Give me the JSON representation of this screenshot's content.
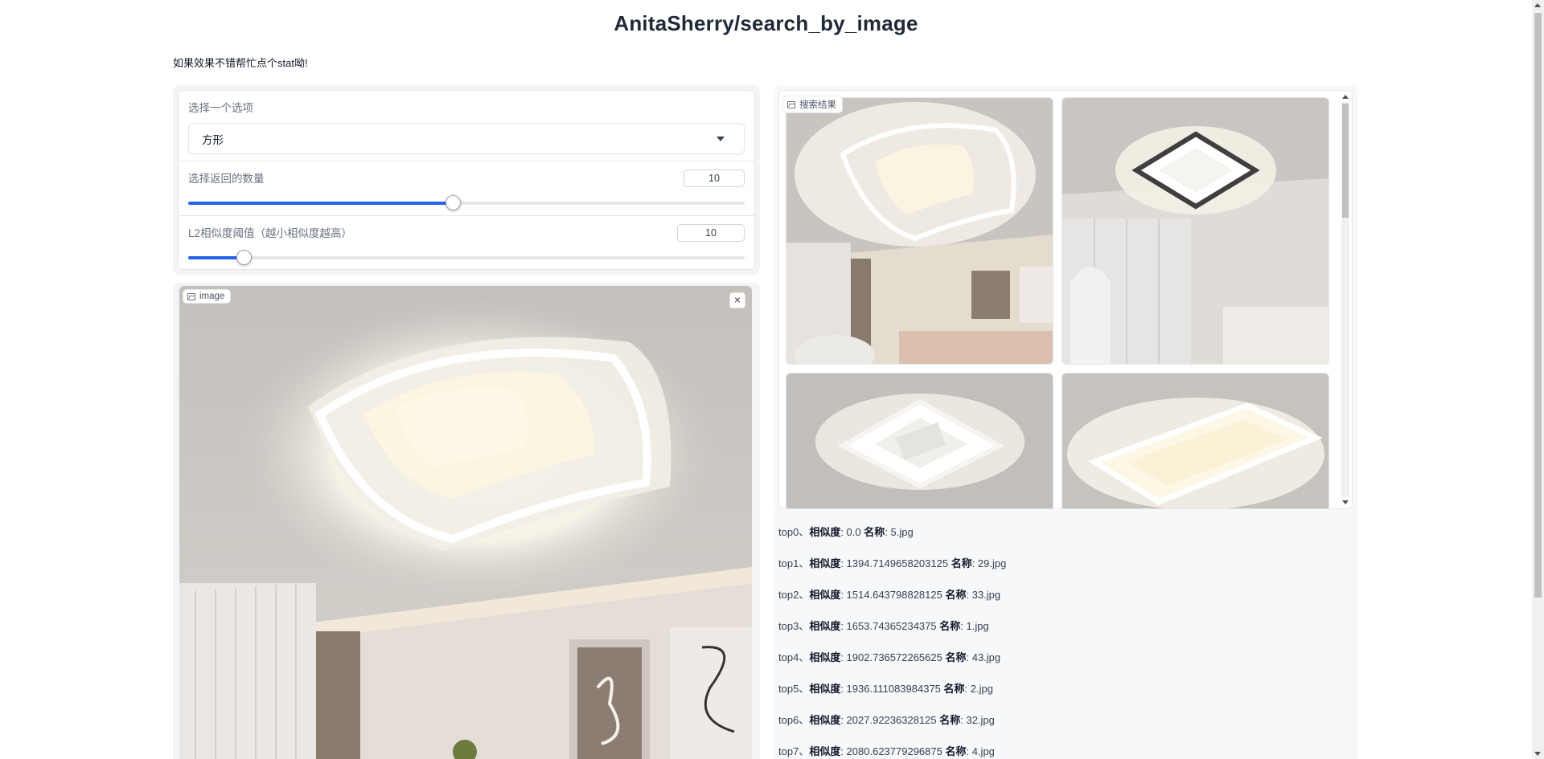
{
  "header": {
    "title": "AnitaSherry/search_by_image",
    "subtitle": "如果效果不错帮忙点个stat呦!"
  },
  "controls": {
    "dropdown": {
      "label": "选择一个选项",
      "value": "方形"
    },
    "count_slider": {
      "label": "选择返回的数量",
      "value": "10",
      "fraction": 0.475
    },
    "threshold_slider": {
      "label": "L2相似度阈值（越小相似度越高）",
      "value": "10",
      "fraction": 0.1
    }
  },
  "image_input": {
    "label": "image",
    "close": "×"
  },
  "gallery": {
    "label": "搜索结果"
  },
  "results": [
    {
      "rank": "top0、",
      "sim_label": "相似度",
      "sim": ": 0.0 ",
      "name_label": "名称",
      "name": ": 5.jpg"
    },
    {
      "rank": "top1、",
      "sim_label": "相似度",
      "sim": ": 1394.7149658203125 ",
      "name_label": "名称",
      "name": ": 29.jpg"
    },
    {
      "rank": "top2、",
      "sim_label": "相似度",
      "sim": ": 1514.643798828125 ",
      "name_label": "名称",
      "name": ": 33.jpg"
    },
    {
      "rank": "top3、",
      "sim_label": "相似度",
      "sim": ": 1653.74365234375 ",
      "name_label": "名称",
      "name": ": 1.jpg"
    },
    {
      "rank": "top4、",
      "sim_label": "相似度",
      "sim": ": 1902.736572265625 ",
      "name_label": "名称",
      "name": ": 43.jpg"
    },
    {
      "rank": "top5、",
      "sim_label": "相似度",
      "sim": ": 1936.111083984375 ",
      "name_label": "名称",
      "name": ": 2.jpg"
    },
    {
      "rank": "top6、",
      "sim_label": "相似度",
      "sim": ": 2027.92236328125 ",
      "name_label": "名称",
      "name": ": 32.jpg"
    },
    {
      "rank": "top7、",
      "sim_label": "相似度",
      "sim": ": 2080.623779296875 ",
      "name_label": "名称",
      "name": ": 4.jpg"
    }
  ],
  "colors": {
    "accent": "#2563eb",
    "panel_bg": "#f3f4f6",
    "border": "#e5e7eb"
  }
}
